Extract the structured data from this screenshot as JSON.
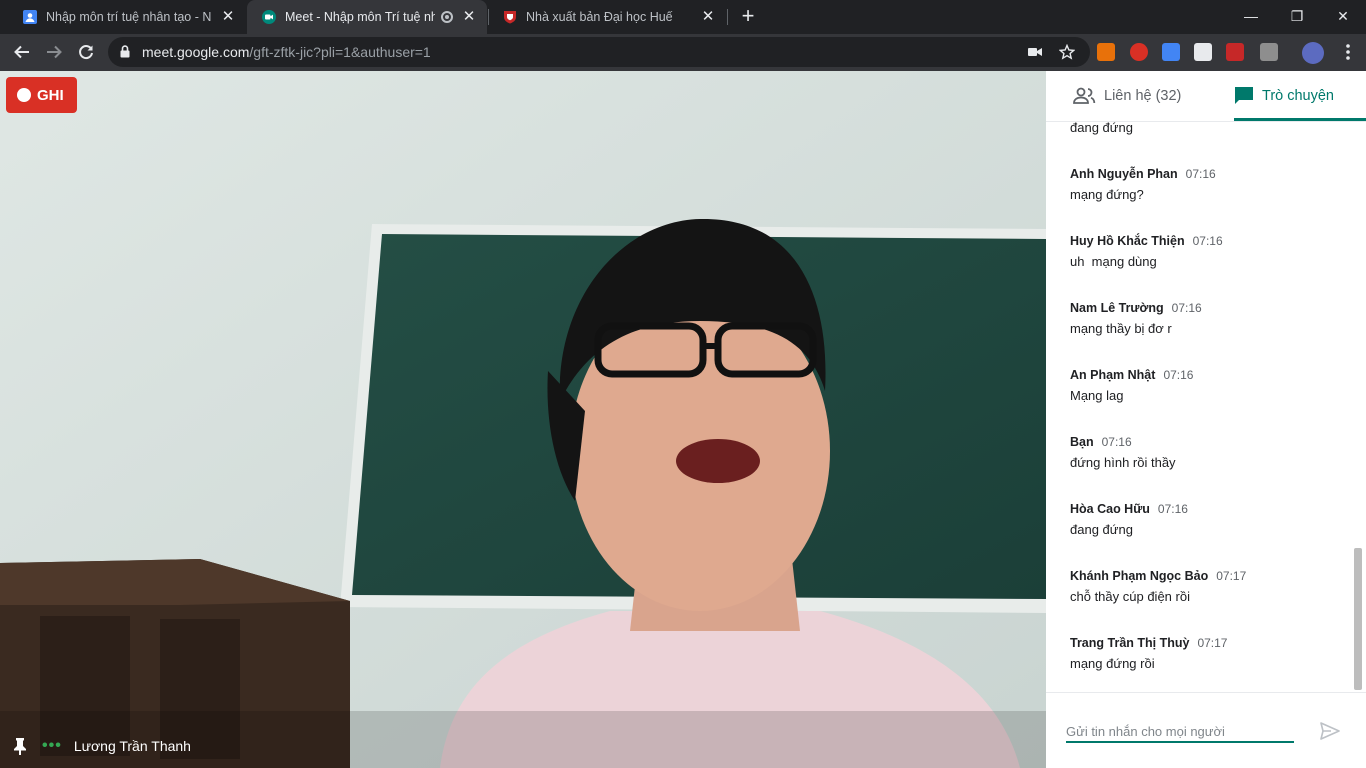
{
  "browser": {
    "tabs": [
      {
        "title": "Nhập môn trí tuệ nhân tạo - Nhóm",
        "close": "✕"
      },
      {
        "title": "Meet - Nhập môn Trí tuệ nhân tạo",
        "close": "✕"
      },
      {
        "title": "Nhà xuất bản Đại học Huế",
        "close": "✕"
      }
    ],
    "new_tab": "+",
    "window_buttons": {
      "minimize": "—",
      "restore": "❐",
      "close": "✕"
    }
  },
  "toolbar": {
    "url_host": "meet.google.com",
    "url_path": "/gft-zftk-jic?pli=1&authuser=1"
  },
  "meeting": {
    "recording_label": "GHI",
    "speaker_name": "Lương Trần Thanh",
    "speaking_indicator": "•••"
  },
  "panel": {
    "people_tab": "Liên hệ (32)",
    "chat_tab": "Trò chuyện",
    "partial_message": "đang đứng",
    "messages": [
      {
        "sender": "Anh Nguyễn Phan",
        "time": "07:16",
        "text": "mạng đứng?"
      },
      {
        "sender": "Huy Hồ Khắc Thiện",
        "time": "07:16",
        "text": "uh  mạng dùng"
      },
      {
        "sender": "Nam Lê Trường",
        "time": "07:16",
        "text": "mạng thầy bị đơ r"
      },
      {
        "sender": "An Phạm Nhật",
        "time": "07:16",
        "text": "Mạng lag"
      },
      {
        "sender": "Bạn",
        "time": "07:16",
        "text": "đứng hình rồi thầy"
      },
      {
        "sender": "Hòa Cao Hữu",
        "time": "07:16",
        "text": "đang đứng"
      },
      {
        "sender": "Khánh Phạm Ngọc Bảo",
        "time": "07:17",
        "text": "chỗ thầy cúp điện rồi"
      },
      {
        "sender": "Trang Trần Thị Thuỳ",
        "time": "07:17",
        "text": "mạng đứng rồi"
      }
    ],
    "composer_placeholder": "Gửi tin nhắn cho mọi người"
  },
  "colors": {
    "accent": "#00796b",
    "record": "#d93025",
    "speaking": "#34a853"
  }
}
